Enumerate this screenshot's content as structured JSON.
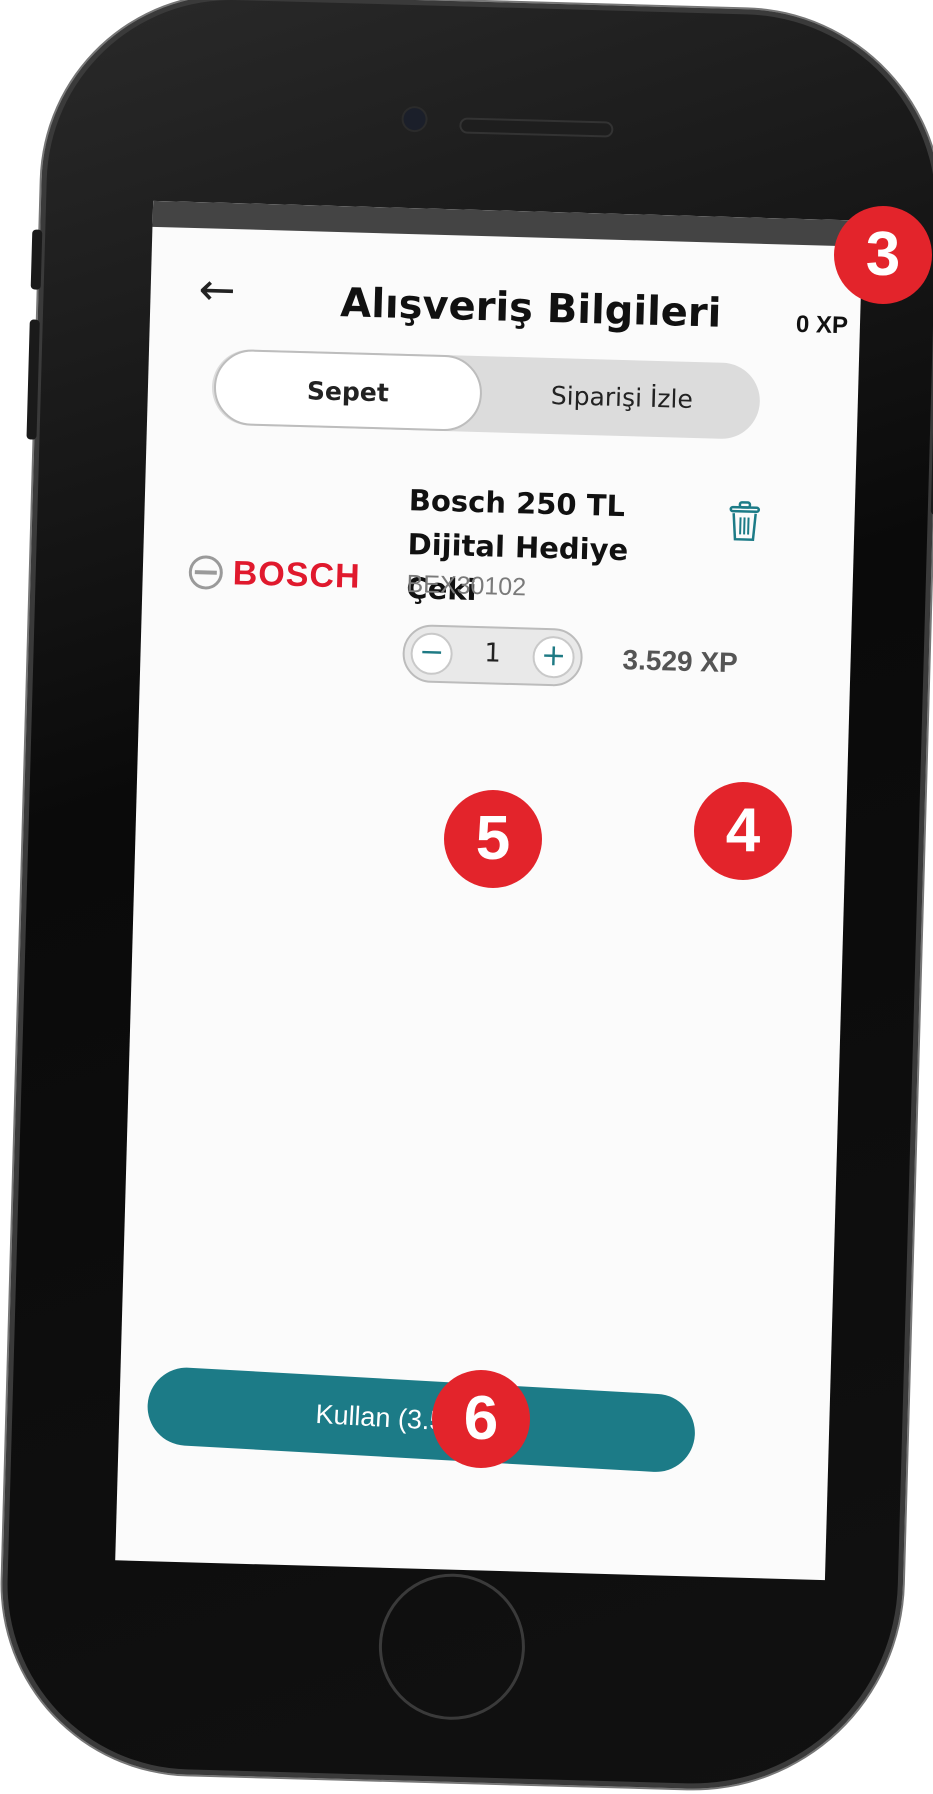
{
  "header": {
    "title": "Alışveriş Bilgileri",
    "xp_balance": "0 XP"
  },
  "tabs": [
    {
      "label": "Sepet",
      "active": true
    },
    {
      "label": "Siparişi İzle",
      "active": false
    }
  ],
  "cart_item": {
    "brand_logo": "BOSCH",
    "name": "Bosch 250 TL Dijital Hediye Çeki",
    "sku": "BEX30102",
    "quantity": "1",
    "price": "3.529 XP",
    "minus_symbol": "−",
    "plus_symbol": "+"
  },
  "use_button": {
    "label": "Kullan (3.529 XP)"
  },
  "badges": {
    "balance": "3",
    "price": "4",
    "stepper": "5",
    "use": "6"
  },
  "colors": {
    "accent": "#1c7b87",
    "badge": "#e3242b",
    "brand": "#e0192d"
  },
  "icons": [
    "back-arrow-icon",
    "trash-icon",
    "bosch-logo-icon"
  ]
}
